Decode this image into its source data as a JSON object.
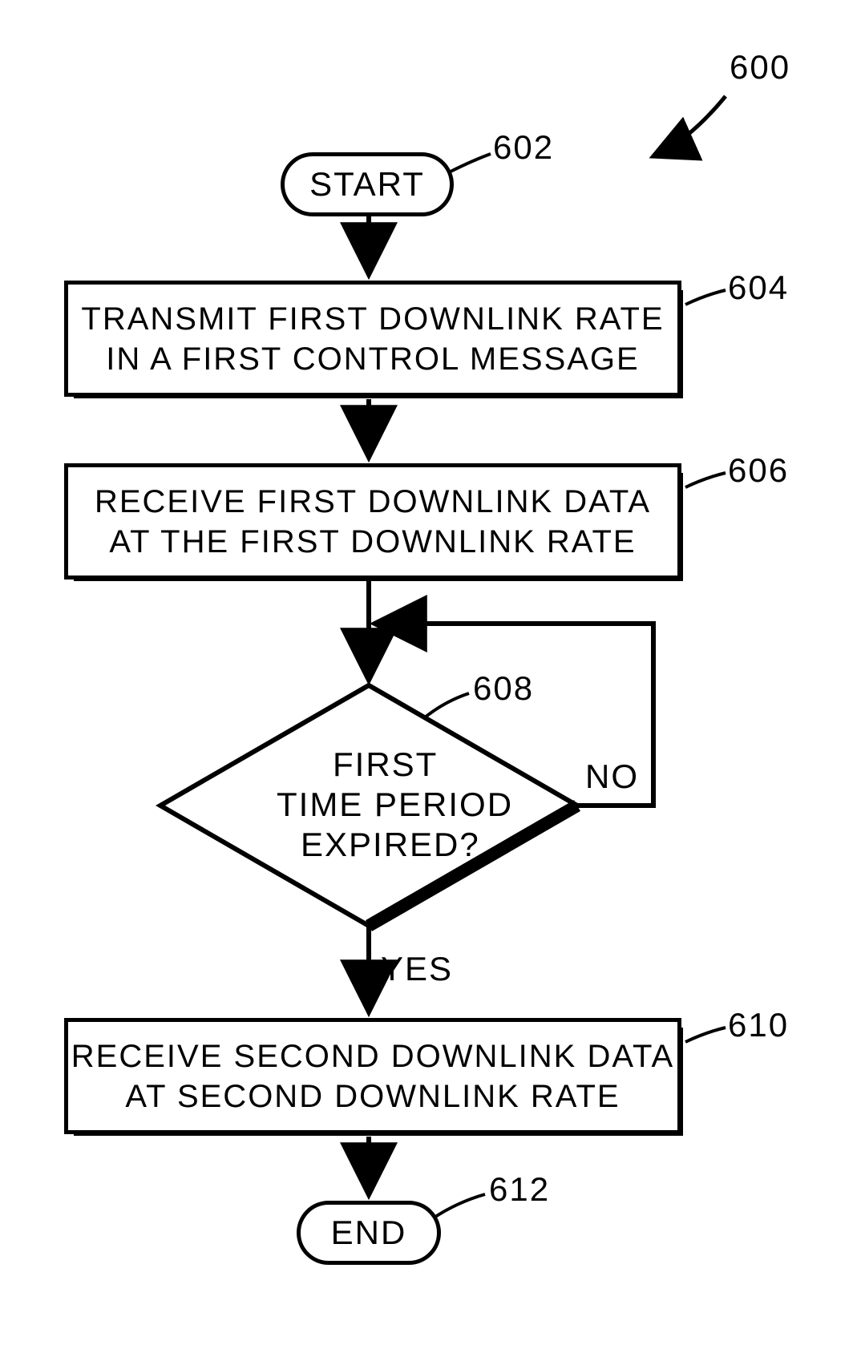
{
  "figure_ref": "600",
  "nodes": {
    "start": {
      "text": "START",
      "ref": "602"
    },
    "step1": {
      "text": "TRANSMIT FIRST DOWNLINK RATE\nIN A FIRST CONTROL MESSAGE",
      "ref": "604"
    },
    "step2": {
      "text": "RECEIVE FIRST DOWNLINK DATA\nAT THE FIRST DOWNLINK RATE",
      "ref": "606"
    },
    "decision": {
      "line1": "FIRST",
      "line2": "TIME PERIOD",
      "line3": "EXPIRED?",
      "ref": "608"
    },
    "step3": {
      "text": "RECEIVE SECOND DOWNLINK DATA\nAT SECOND DOWNLINK RATE",
      "ref": "610"
    },
    "end": {
      "text": "END",
      "ref": "612"
    }
  },
  "edges": {
    "yes": "YES",
    "no": "NO"
  }
}
